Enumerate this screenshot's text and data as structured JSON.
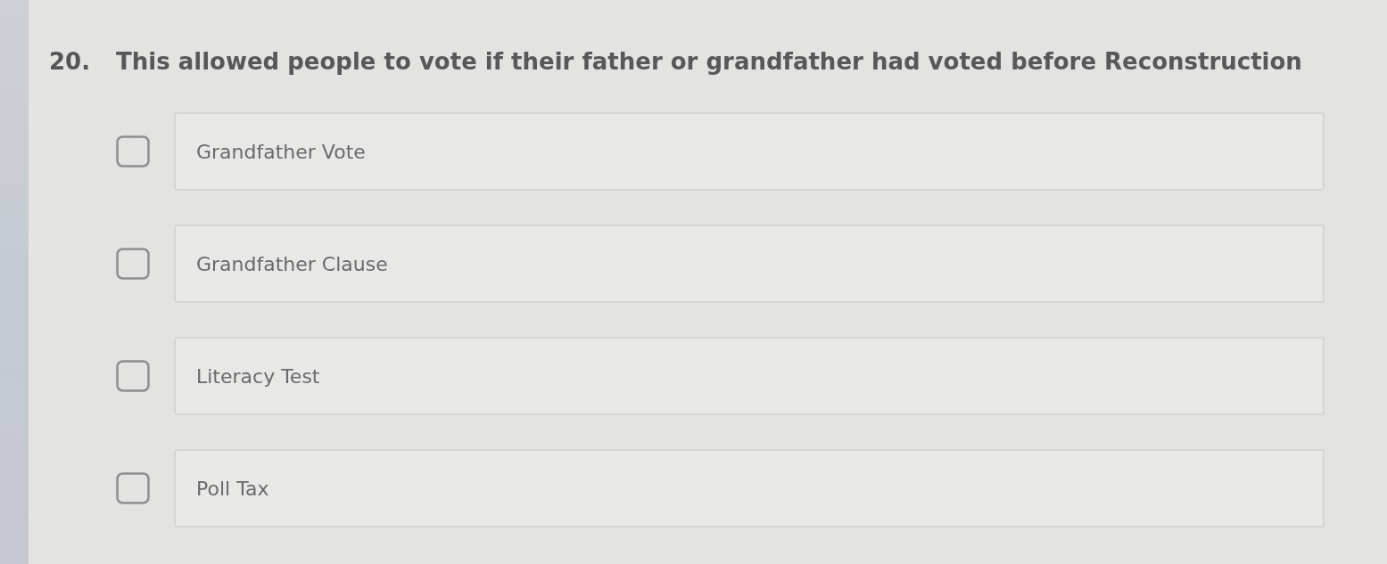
{
  "question": {
    "number": "20.",
    "text": "This allowed people to vote if their father or grandfather had voted before Reconstruction"
  },
  "options": [
    {
      "label": "Grandfather Vote",
      "checked": false
    },
    {
      "label": "Grandfather Clause",
      "checked": false
    },
    {
      "label": "Literacy Test",
      "checked": false
    },
    {
      "label": "Poll Tax",
      "checked": false
    }
  ]
}
